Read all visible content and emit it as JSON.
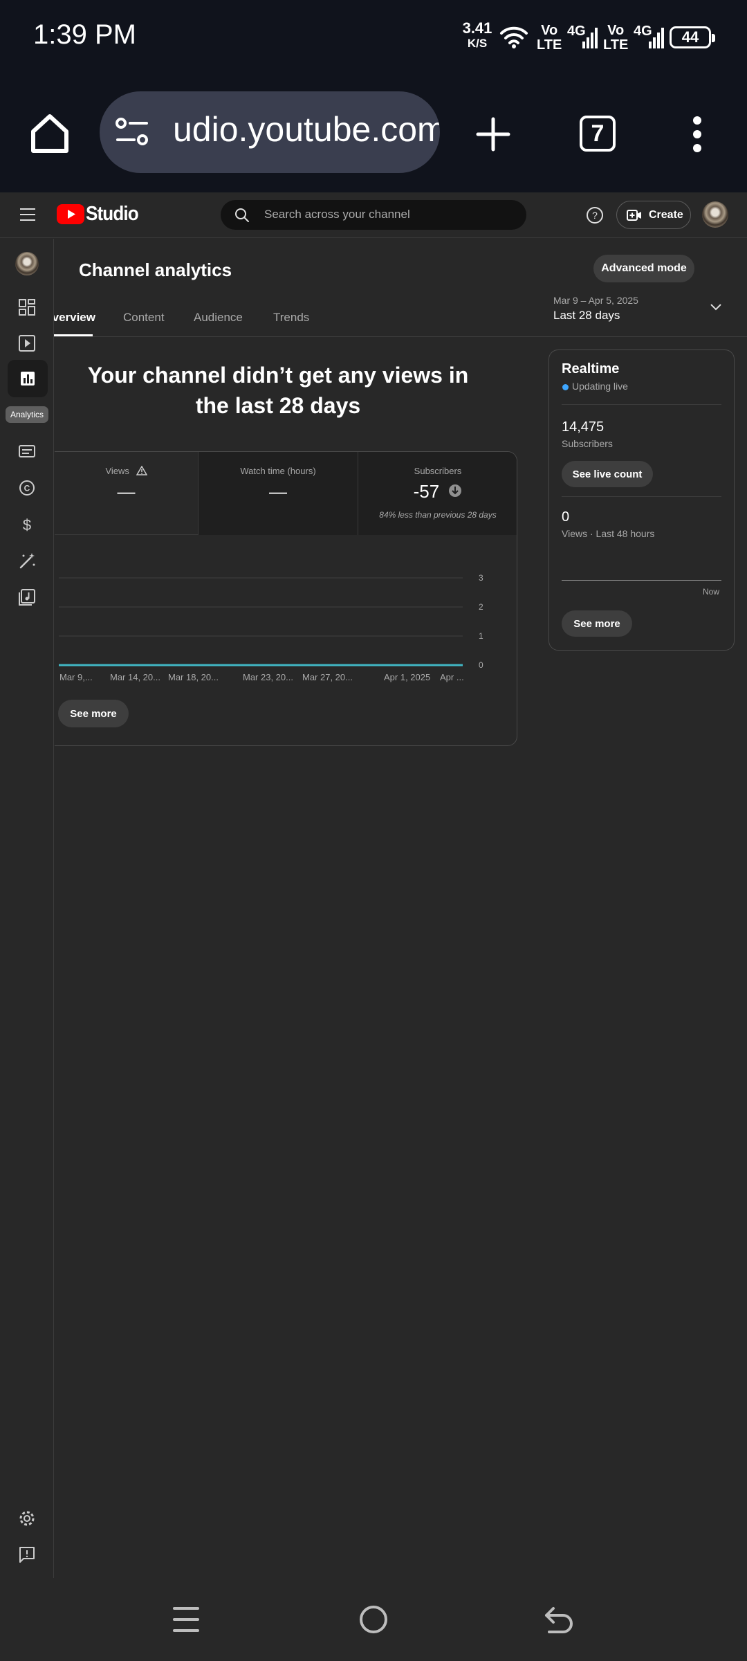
{
  "status_bar": {
    "time": "1:39 PM",
    "net_speed": "3.41",
    "net_speed_unit": "K/S",
    "volte1_top": "Vo",
    "volte1_bottom": "LTE",
    "net1": "4G",
    "volte2_top": "Vo",
    "volte2_bottom": "LTE",
    "net2": "4G",
    "battery": "44"
  },
  "browser": {
    "url": "udio.youtube.com",
    "tab_count": "7"
  },
  "header": {
    "logo_text": "Studio",
    "search_placeholder": "Search across your channel",
    "create_label": "Create"
  },
  "sidebar": {
    "analytics_tooltip": "Analytics"
  },
  "page": {
    "title": "Channel analytics",
    "advanced_mode": "Advanced mode",
    "date_range": "Mar 9 – Apr 5, 2025",
    "date_label": "Last 28 days",
    "tabs": [
      "verview",
      "Content",
      "Audience",
      "Trends"
    ],
    "headline": "Your channel didn’t get any views in the last 28 days"
  },
  "metrics": {
    "views_label": "Views",
    "views_value": "—",
    "watch_label": "Watch time (hours)",
    "watch_value": "—",
    "subs_label": "Subscribers",
    "subs_value": "-57",
    "subs_note": "84% less than previous 28 days"
  },
  "chart_data": {
    "type": "line",
    "x": [
      "Mar 9,...",
      "Mar 14, 20...",
      "Mar 18, 20...",
      "Mar 23, 20...",
      "Mar 27, 20...",
      "Apr 1, 2025",
      "Apr ..."
    ],
    "y_ticks": [
      "0",
      "1",
      "2",
      "3"
    ],
    "series": [
      {
        "values": [
          0,
          0,
          0,
          0,
          0,
          0,
          0
        ]
      }
    ],
    "ylim": [
      0,
      3
    ],
    "grid": true,
    "line_color": "#41b6c4",
    "see_more": "See more"
  },
  "realtime": {
    "title": "Realtime",
    "status": "Updating live",
    "subscribers": "14,475",
    "subscribers_label": "Subscribers",
    "live_count": "See live count",
    "views": "0",
    "views_label": "Views · Last 48 hours",
    "now": "Now",
    "see_more": "See more"
  },
  "colors": {
    "background": "#282828",
    "status_bar": "#10131c",
    "url_pill": "#3a3e4f",
    "accent_red": "#ff0000",
    "live_dot": "#3ea6ff"
  }
}
